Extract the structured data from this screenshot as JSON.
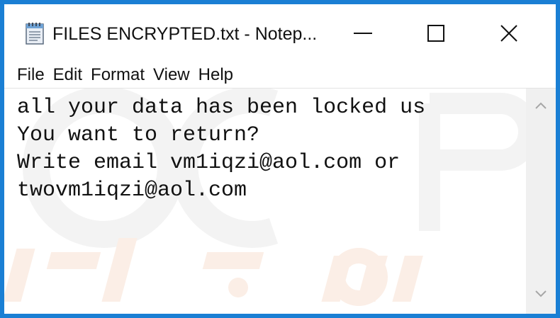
{
  "window": {
    "title": "FILES ENCRYPTED.txt - Notep..."
  },
  "menu": {
    "items": [
      "File",
      "Edit",
      "Format",
      "View",
      "Help"
    ]
  },
  "editor": {
    "lines": [
      "all your data has been locked us",
      "You want to return?",
      "Write email vm1iqzi@aol.com or",
      "twovm1iqzi@aol.com"
    ]
  },
  "colors": {
    "frame_border": "#1a7fd4",
    "background": "#ffffff",
    "text": "#111111",
    "scrollbar_bg": "#f0f0f0"
  },
  "icons": {
    "app": "notepad-icon",
    "minimize": "minimize-icon",
    "maximize": "maximize-icon",
    "close": "close-icon",
    "scroll_up": "chevron-up-icon",
    "scroll_down": "chevron-down-icon"
  }
}
